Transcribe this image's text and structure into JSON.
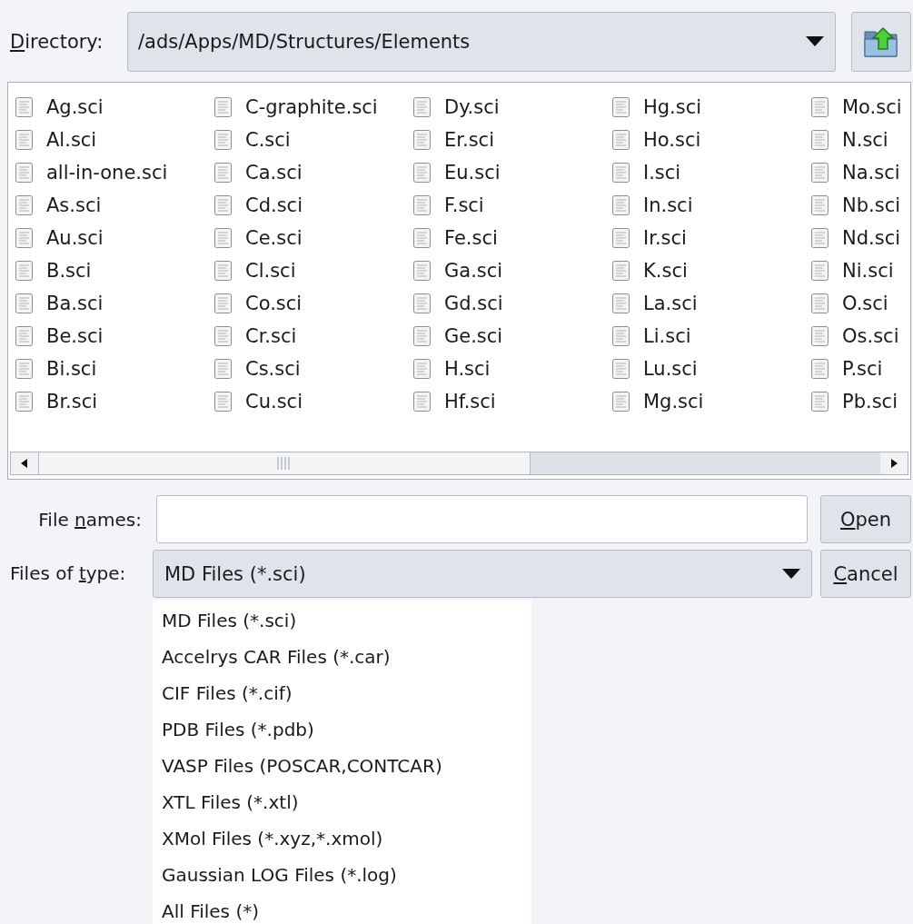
{
  "directory": {
    "label": {
      "key": "D",
      "post": "irectory:"
    },
    "path": "/ads/Apps/MD/Structures/Elements"
  },
  "files": [
    [
      "Ag.sci",
      "Al.sci",
      "all-in-one.sci",
      "As.sci",
      "Au.sci",
      "B.sci",
      "Ba.sci",
      "Be.sci",
      "Bi.sci",
      "Br.sci"
    ],
    [
      "C-graphite.sci",
      "C.sci",
      "Ca.sci",
      "Cd.sci",
      "Ce.sci",
      "Cl.sci",
      "Co.sci",
      "Cr.sci",
      "Cs.sci",
      "Cu.sci"
    ],
    [
      "Dy.sci",
      "Er.sci",
      "Eu.sci",
      "F.sci",
      "Fe.sci",
      "Ga.sci",
      "Gd.sci",
      "Ge.sci",
      "H.sci",
      "Hf.sci"
    ],
    [
      "Hg.sci",
      "Ho.sci",
      "I.sci",
      "In.sci",
      "Ir.sci",
      "K.sci",
      "La.sci",
      "Li.sci",
      "Lu.sci",
      "Mg.sci"
    ],
    [
      "Mo.sci",
      "N.sci",
      "Na.sci",
      "Nb.sci",
      "Nd.sci",
      "Ni.sci",
      "O.sci",
      "Os.sci",
      "P.sci",
      "Pb.sci"
    ]
  ],
  "file_names": {
    "label": {
      "pre": "File ",
      "key": "n",
      "post": "ames:"
    }
  },
  "open_button": {
    "key": "O",
    "post": "pen"
  },
  "files_of_type": {
    "label": {
      "pre": "Files of ",
      "key": "t",
      "post": "ype:"
    },
    "value": "MD Files (*.sci)"
  },
  "cancel_button": {
    "key": "C",
    "post": "ancel"
  },
  "type_options": [
    "MD Files (*.sci)",
    "Accelrys CAR Files (*.car)",
    "CIF Files (*.cif)",
    "PDB Files (*.pdb)",
    "VASP Files (POSCAR,CONTCAR)",
    "XTL Files (*.xtl)",
    "XMol Files (*.xyz,*.xmol)",
    "Gaussian LOG Files (*.log)",
    "All Files (*)"
  ]
}
